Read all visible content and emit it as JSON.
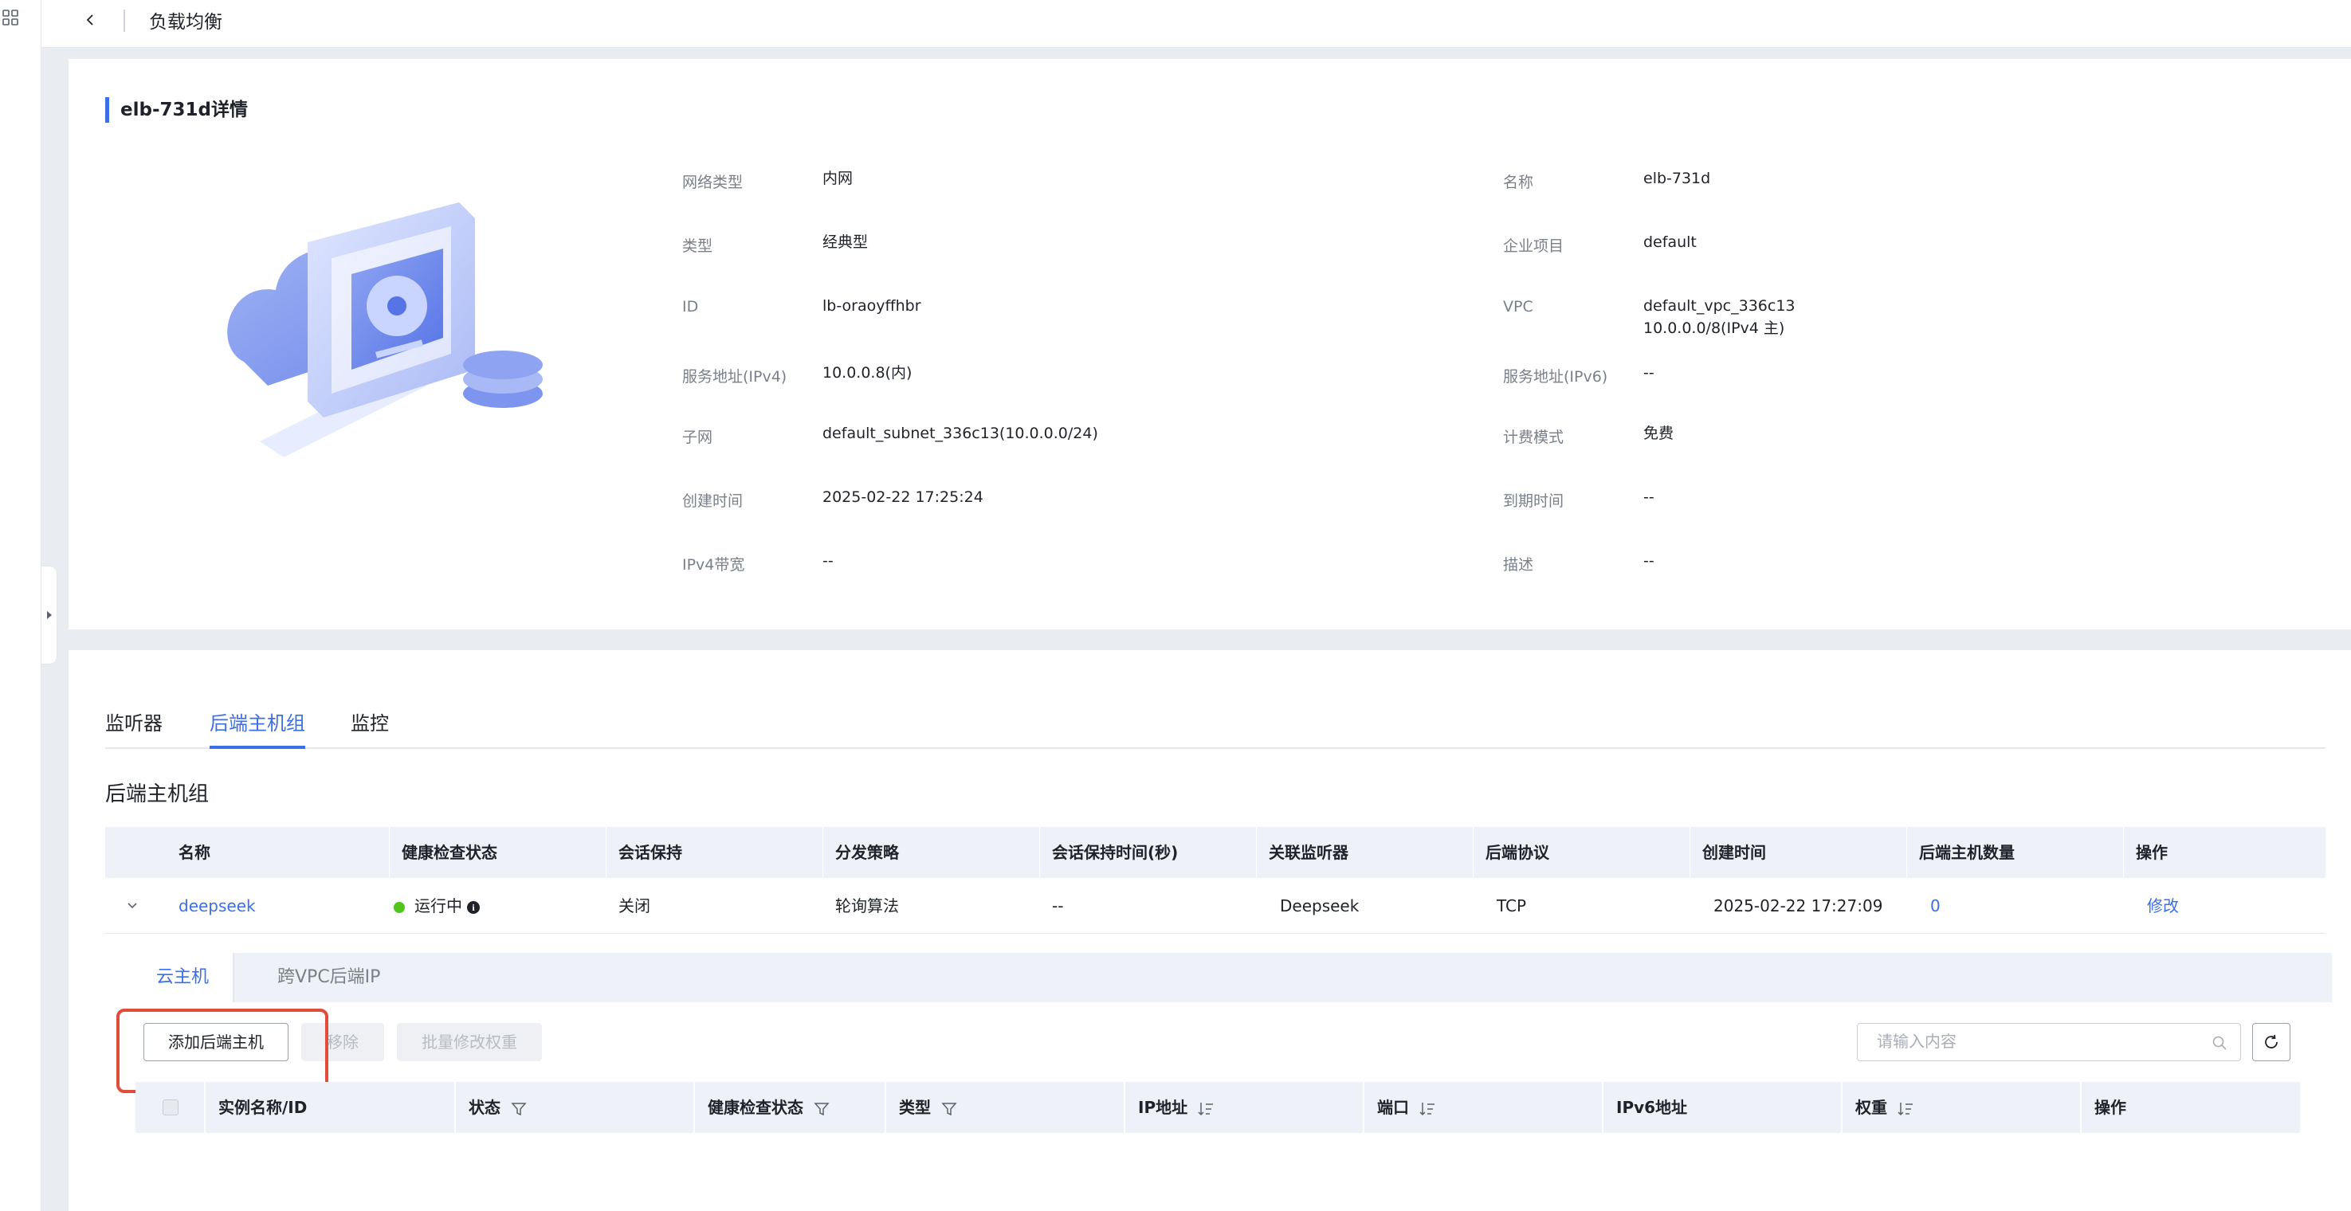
{
  "header": {
    "title": "负载均衡"
  },
  "detail": {
    "section_title": "elb-731d详情",
    "left_props": [
      {
        "label": "网络类型",
        "value": "内网"
      },
      {
        "label": "类型",
        "value": "经典型"
      },
      {
        "label": "ID",
        "value": "lb-oraoyffhbr"
      },
      {
        "label": "服务地址(IPv4)",
        "value": "10.0.0.8(内)"
      },
      {
        "label": "子网",
        "value": "default_subnet_336c13(10.0.0.0/24)"
      },
      {
        "label": "创建时间",
        "value": "2025-02-22 17:25:24"
      },
      {
        "label": "IPv4带宽",
        "value": "--"
      }
    ],
    "right_props": [
      {
        "label": "名称",
        "value": "elb-731d"
      },
      {
        "label": "企业项目",
        "value": "default"
      },
      {
        "label": "VPC",
        "value": "default_vpc_336c13",
        "value2": "10.0.0.0/8(IPv4 主)"
      },
      {
        "label": "服务地址(IPv6)",
        "value": "--"
      },
      {
        "label": "计费模式",
        "value": "免费"
      },
      {
        "label": "到期时间",
        "value": "--"
      },
      {
        "label": "描述",
        "value": "--"
      }
    ]
  },
  "tabs": [
    {
      "label": "监听器",
      "active": false
    },
    {
      "label": "后端主机组",
      "active": true
    },
    {
      "label": "监控",
      "active": false
    }
  ],
  "group": {
    "heading": "后端主机组",
    "columns": [
      "名称",
      "健康检查状态",
      "会话保持",
      "分发策略",
      "会话保持时间(秒)",
      "关联监听器",
      "后端协议",
      "创建时间",
      "后端主机数量",
      "操作"
    ],
    "row": {
      "name": "deepseek",
      "health": "运行中",
      "session": "关闭",
      "policy": "轮询算法",
      "session_time": "--",
      "listener": "Deepseek",
      "protocol": "TCP",
      "created": "2025-02-22 17:27:09",
      "host_count": "0",
      "action": "修改"
    }
  },
  "sub_tabs": [
    {
      "label": "云主机",
      "active": true
    },
    {
      "label": "跨VPC后端IP",
      "active": false
    }
  ],
  "toolbar": {
    "add_label": "添加后端主机",
    "remove_label": "移除",
    "batch_label": "批量修改权重",
    "search_placeholder": "请输入内容"
  },
  "instance_columns": [
    "实例名称/ID",
    "状态",
    "健康检查状态",
    "类型",
    "IP地址",
    "端口",
    "IPv6地址",
    "权重",
    "操作"
  ],
  "colors": {
    "accent": "#3b6ee8",
    "highlight": "#e34b3b",
    "running": "#52c41a"
  }
}
